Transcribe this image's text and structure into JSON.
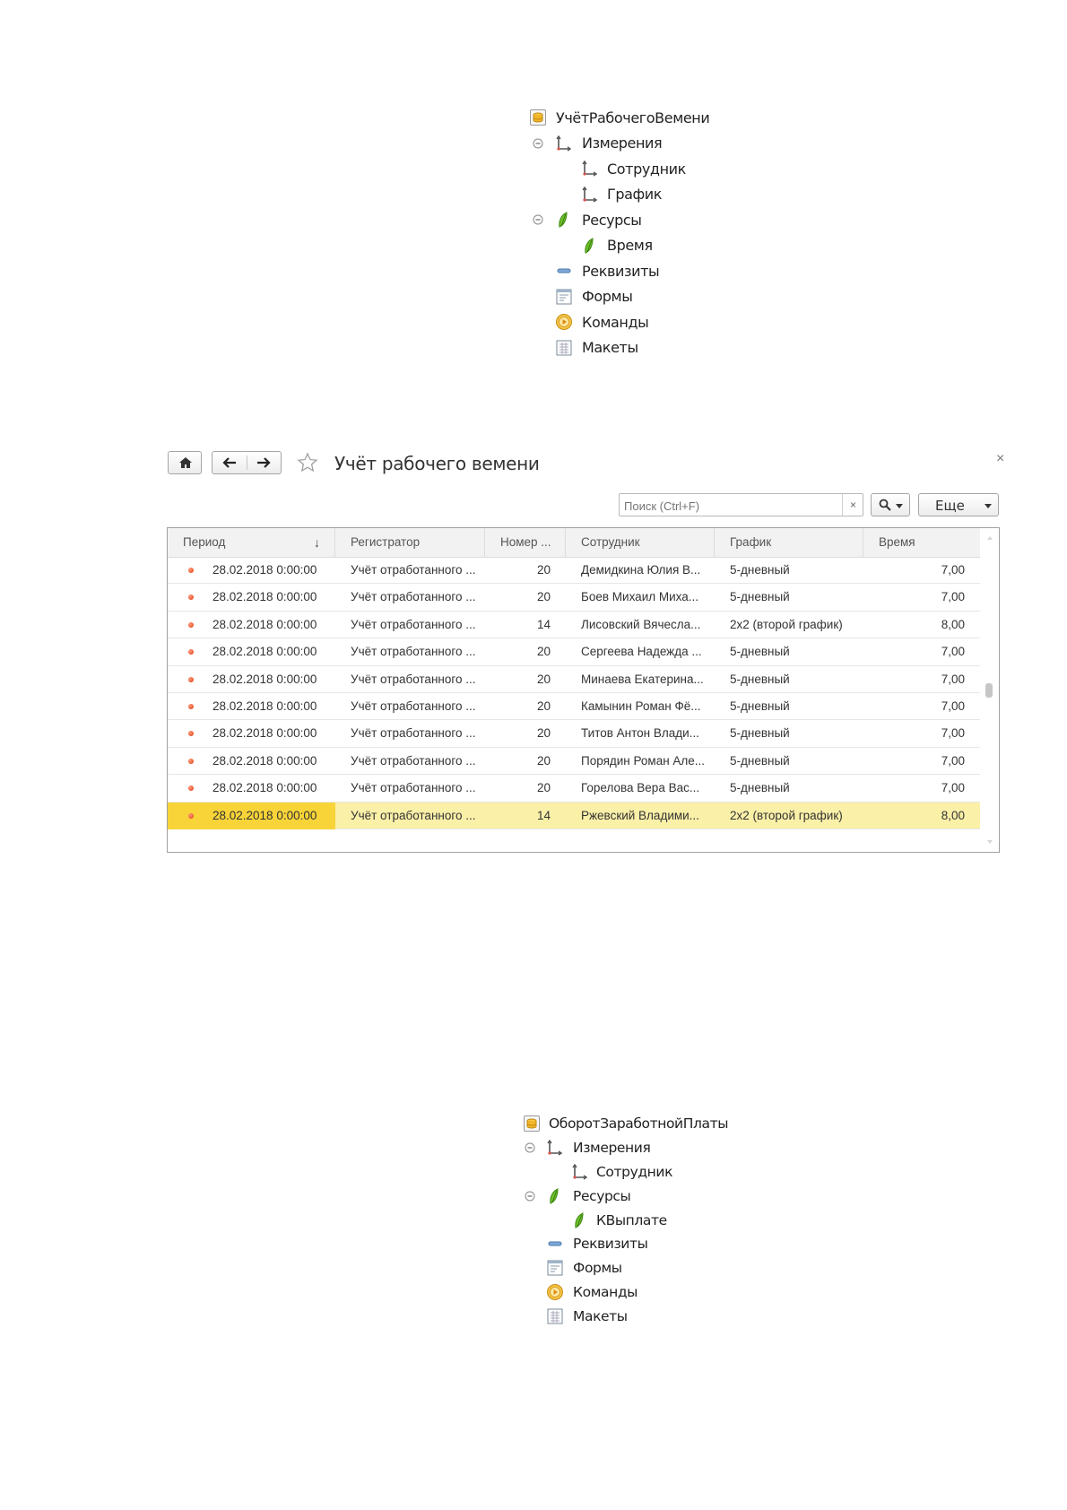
{
  "tree1": {
    "register_name": "УчётРабочегоВемени",
    "dimensions_label": "Измерения",
    "dimension_items": [
      "Сотрудник",
      "График"
    ],
    "resources_label": "Ресурсы",
    "resource_items": [
      "Время"
    ],
    "attributes_label": "Реквизиты",
    "forms_label": "Формы",
    "commands_label": "Команды",
    "templates_label": "Макеты"
  },
  "form": {
    "title": "Учёт рабочего вемени",
    "search_placeholder": "Поиск (Ctrl+F)",
    "more_label": "Еще",
    "clear_label": "×",
    "close_label": "×",
    "columns": {
      "period": "Период",
      "registrar": "Регистратор",
      "number": "Номер ...",
      "employee": "Сотрудник",
      "schedule": "График",
      "time": "Время"
    },
    "sort_indicator": "↓",
    "rows": [
      {
        "period": "28.02.2018 0:00:00",
        "registrar": "Учёт отработанного ...",
        "number": "20",
        "employee": "Демидкина Юлия В...",
        "schedule": "5-дневный",
        "time": "7,00"
      },
      {
        "period": "28.02.2018 0:00:00",
        "registrar": "Учёт отработанного ...",
        "number": "20",
        "employee": "Боев Михаил Миха...",
        "schedule": "5-дневный",
        "time": "7,00"
      },
      {
        "period": "28.02.2018 0:00:00",
        "registrar": "Учёт отработанного ...",
        "number": "14",
        "employee": "Лисовский Вячесла...",
        "schedule": "2х2 (второй график)",
        "time": "8,00"
      },
      {
        "period": "28.02.2018 0:00:00",
        "registrar": "Учёт отработанного ...",
        "number": "20",
        "employee": "Сергеева Надежда ...",
        "schedule": "5-дневный",
        "time": "7,00"
      },
      {
        "period": "28.02.2018 0:00:00",
        "registrar": "Учёт отработанного ...",
        "number": "20",
        "employee": "Минаева Екатерина...",
        "schedule": "5-дневный",
        "time": "7,00"
      },
      {
        "period": "28.02.2018 0:00:00",
        "registrar": "Учёт отработанного ...",
        "number": "20",
        "employee": "Камынин Роман Фё...",
        "schedule": "5-дневный",
        "time": "7,00"
      },
      {
        "period": "28.02.2018 0:00:00",
        "registrar": "Учёт отработанного ...",
        "number": "20",
        "employee": "Титов Антон Влади...",
        "schedule": "5-дневный",
        "time": "7,00"
      },
      {
        "period": "28.02.2018 0:00:00",
        "registrar": "Учёт отработанного ...",
        "number": "20",
        "employee": "Порядин Роман Але...",
        "schedule": "5-дневный",
        "time": "7,00"
      },
      {
        "period": "28.02.2018 0:00:00",
        "registrar": "Учёт отработанного ...",
        "number": "20",
        "employee": "Горелова Вера Вас...",
        "schedule": "5-дневный",
        "time": "7,00"
      },
      {
        "period": "28.02.2018 0:00:00",
        "registrar": "Учёт отработанного ...",
        "number": "14",
        "employee": "Ржевский Владими...",
        "schedule": "2х2 (второй график)",
        "time": "8,00"
      }
    ],
    "selected_row": 9
  },
  "tree2": {
    "register_name": "ОборотЗаработнойПлаты",
    "dimensions_label": "Измерения",
    "dimension_items": [
      "Сотрудник"
    ],
    "resources_label": "Ресурсы",
    "resource_items": [
      "КВыплате"
    ],
    "attributes_label": "Реквизиты",
    "forms_label": "Формы",
    "commands_label": "Команды",
    "templates_label": "Макеты"
  },
  "colors": {
    "selected_row": "#fbf0a8",
    "selected_cell": "#f8d438",
    "header_bg": "#f2f2f2"
  }
}
